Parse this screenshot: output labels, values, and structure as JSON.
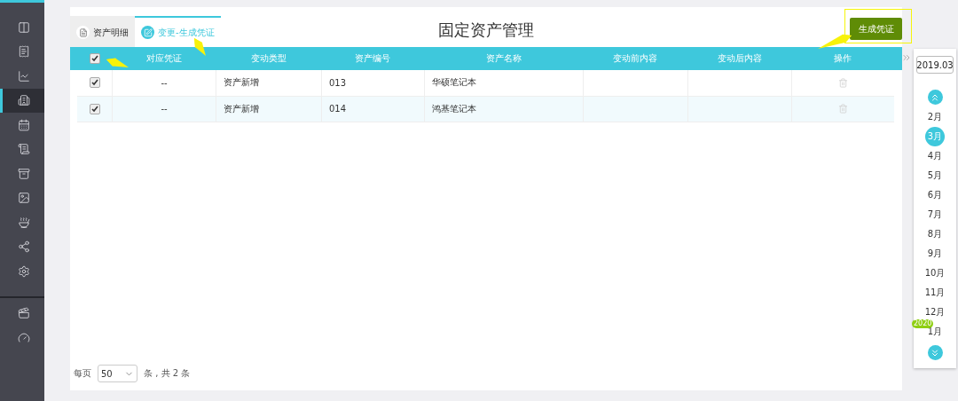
{
  "sidebar": {
    "items": [
      {
        "selected": false
      },
      {
        "selected": false
      },
      {
        "selected": false
      },
      {
        "selected": true
      },
      {
        "selected": false
      },
      {
        "selected": false
      },
      {
        "selected": false
      },
      {
        "selected": false
      },
      {
        "selected": false
      },
      {
        "selected": false
      },
      {
        "selected": false
      }
    ],
    "bottom_items": [
      {
        "selected": false
      },
      {
        "selected": false
      }
    ]
  },
  "tabs": [
    {
      "label": "资产明细",
      "selected": false
    },
    {
      "label": "变更-生成凭证",
      "selected": true
    }
  ],
  "title": "固定资产管理",
  "generate_button": "生成凭证",
  "table": {
    "all_checked": true,
    "columns": [
      "对应凭证",
      "变动类型",
      "资产编号",
      "资产名称",
      "变动前内容",
      "变动后内容",
      "操作"
    ],
    "rows": [
      {
        "checked": true,
        "voucher": "--",
        "change_type": "资产新增",
        "asset_code": "013",
        "asset_name": "华硕笔记本"
      },
      {
        "checked": true,
        "voucher": "--",
        "change_type": "资产新增",
        "asset_code": "014",
        "asset_name": "鸿基笔记本"
      }
    ]
  },
  "pagination": {
    "label": "每页",
    "page_size": "50",
    "summary": "条 , 共 2 条"
  },
  "calendar": {
    "period": "2019.03",
    "months": [
      {
        "label": "2月",
        "selected": false
      },
      {
        "label": "3月",
        "selected": true
      },
      {
        "label": "4月",
        "selected": false
      },
      {
        "label": "5月",
        "selected": false
      },
      {
        "label": "6月",
        "selected": false
      },
      {
        "label": "7月",
        "selected": false
      },
      {
        "label": "8月",
        "selected": false
      },
      {
        "label": "9月",
        "selected": false
      },
      {
        "label": "10月",
        "selected": false
      },
      {
        "label": "11月",
        "selected": false
      },
      {
        "label": "12月",
        "selected": false
      },
      {
        "label": "1月",
        "selected": false,
        "year_badge": "2020"
      }
    ]
  }
}
